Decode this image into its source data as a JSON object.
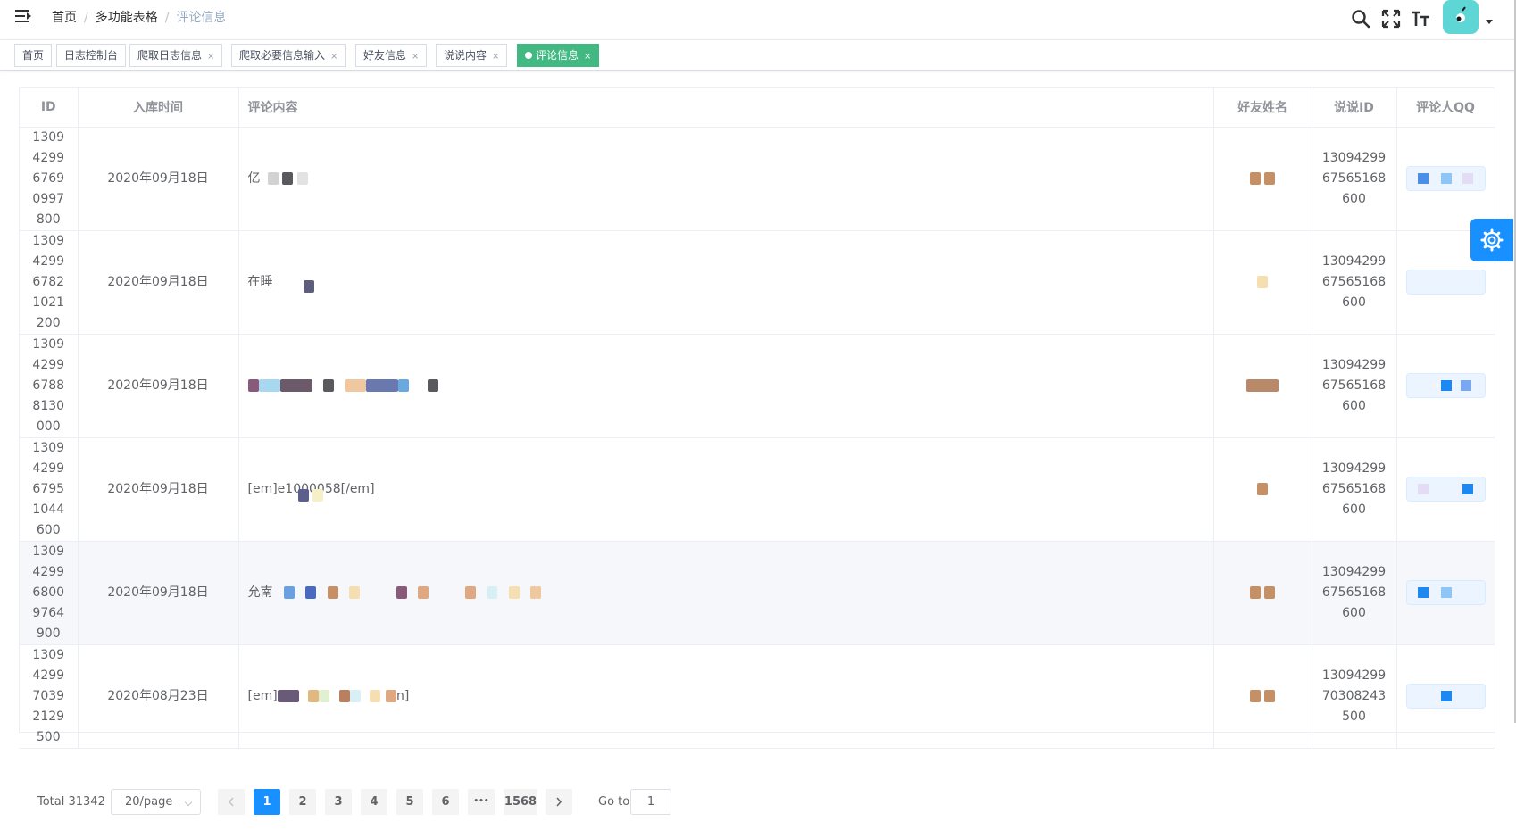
{
  "breadcrumb": [
    "首页",
    "多功能表格",
    "评论信息"
  ],
  "tags": [
    {
      "label": "首页",
      "closable": false,
      "active": false
    },
    {
      "label": "日志控制台",
      "closable": false,
      "active": false
    },
    {
      "label": "爬取日志信息",
      "closable": true,
      "active": false
    },
    {
      "label": "爬取必要信息输入",
      "closable": true,
      "active": false
    },
    {
      "label": "好友信息",
      "closable": true,
      "active": false
    },
    {
      "label": "说说内容",
      "closable": true,
      "active": false
    },
    {
      "label": "评论信息",
      "closable": true,
      "active": true
    }
  ],
  "tag_close": "×",
  "table": {
    "columns": [
      "ID",
      "入库时间",
      "评论内容",
      "好友姓名",
      "说说ID",
      "评论人QQ"
    ],
    "rows": [
      {
        "id": "1309429967690997800",
        "time": "2020年09月18日",
        "content": "亿",
        "shuoshuo_id": "1309429967565168600"
      },
      {
        "id": "1309429967821021200",
        "time": "2020年09月18日",
        "content": "在睡",
        "shuoshuo_id": "1309429967565168600"
      },
      {
        "id": "1309429967888130000",
        "time": "2020年09月18日",
        "content": "",
        "shuoshuo_id": "1309429967565168600"
      },
      {
        "id": "1309429967951044600",
        "time": "2020年09月18日",
        "content": "[em]e1000058[/em]",
        "shuoshuo_id": "1309429967565168600"
      },
      {
        "id": "1309429968009764900",
        "time": "2020年09月18日",
        "content": "允南",
        "shuoshuo_id": "1309429967565168600"
      },
      {
        "id": "1309429970392129500",
        "time": "2020年08月23日",
        "content": "[em]",
        "content_tail": "n]",
        "shuoshuo_id": "1309429970308243500"
      }
    ]
  },
  "pagination": {
    "total": "Total 31342",
    "page_size": "20/page",
    "pages": [
      "1",
      "2",
      "3",
      "4",
      "5",
      "6",
      "•••",
      "1568"
    ],
    "current_page": "1",
    "goto_label": "Go to",
    "goto_value": "1"
  },
  "colors": {
    "accent": "#1890ff",
    "active_tag": "#42b983"
  }
}
